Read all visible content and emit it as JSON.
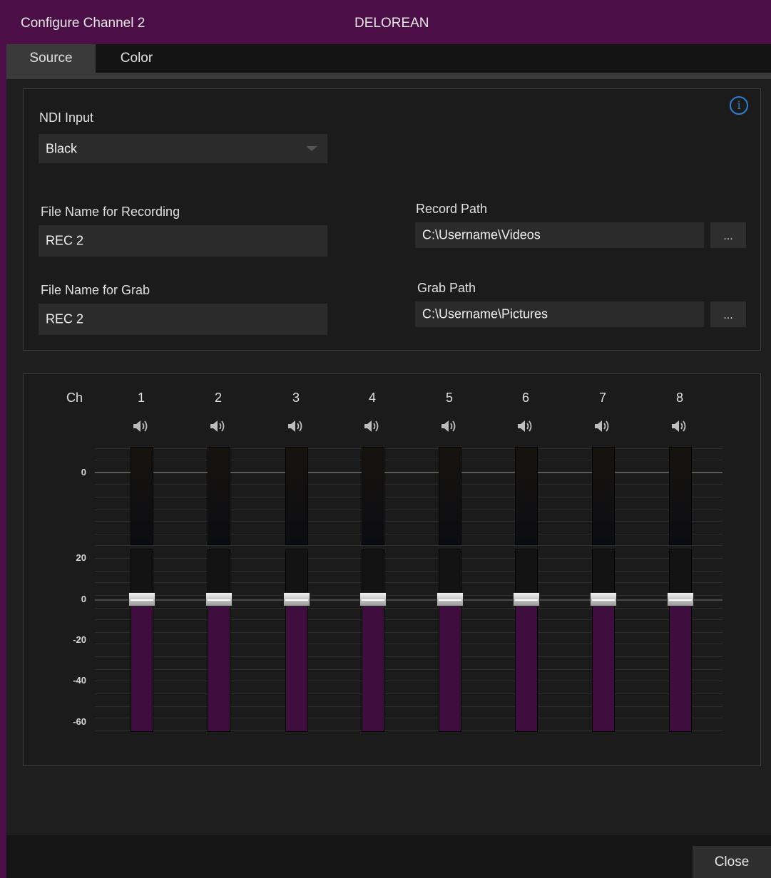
{
  "window": {
    "title": "Configure Channel 2",
    "device": "DELOREAN"
  },
  "tabs": [
    {
      "label": "Source",
      "active": true
    },
    {
      "label": "Color",
      "active": false
    }
  ],
  "source": {
    "ndi_input_label": "NDI Input",
    "ndi_input_value": "Black",
    "file_name_recording_label": "File Name for Recording",
    "file_name_recording_value": "REC 2",
    "record_path_label": "Record Path",
    "record_path_value": "C:\\Username\\Videos",
    "file_name_grab_label": "File Name for Grab",
    "file_name_grab_value": "REC 2",
    "grab_path_label": "Grab Path",
    "grab_path_value": "C:\\Username\\Pictures",
    "browse_label": "...",
    "info_icon": "info-icon"
  },
  "audio": {
    "ch_label": "Ch",
    "channels": [
      "1",
      "2",
      "3",
      "4",
      "5",
      "6",
      "7",
      "8"
    ],
    "speaker_icon": "speaker-icon",
    "meter_scale": [
      "0"
    ],
    "fader_scale": [
      "20",
      "0",
      "-20",
      "-40",
      "-60"
    ],
    "fader_db": [
      0,
      0,
      0,
      0,
      0,
      0,
      0,
      0
    ],
    "fader_range_db": [
      -60,
      20
    ]
  },
  "colors": {
    "accent": "#4b0e47",
    "fader_fill": "#3e0d3d",
    "info_blue": "#2f7fd1"
  },
  "footer": {
    "close_label": "Close"
  }
}
